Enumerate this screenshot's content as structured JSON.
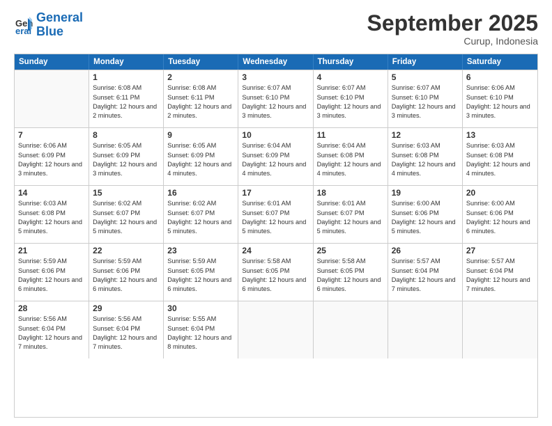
{
  "header": {
    "logo_line1": "General",
    "logo_line2": "Blue",
    "month_title": "September 2025",
    "location": "Curup, Indonesia"
  },
  "days_of_week": [
    "Sunday",
    "Monday",
    "Tuesday",
    "Wednesday",
    "Thursday",
    "Friday",
    "Saturday"
  ],
  "weeks": [
    [
      {
        "day": "",
        "sunrise": "",
        "sunset": "",
        "daylight": "",
        "empty": true
      },
      {
        "day": "1",
        "sunrise": "6:08 AM",
        "sunset": "6:11 PM",
        "daylight": "12 hours and 2 minutes."
      },
      {
        "day": "2",
        "sunrise": "6:08 AM",
        "sunset": "6:11 PM",
        "daylight": "12 hours and 2 minutes."
      },
      {
        "day": "3",
        "sunrise": "6:07 AM",
        "sunset": "6:10 PM",
        "daylight": "12 hours and 3 minutes."
      },
      {
        "day": "4",
        "sunrise": "6:07 AM",
        "sunset": "6:10 PM",
        "daylight": "12 hours and 3 minutes."
      },
      {
        "day": "5",
        "sunrise": "6:07 AM",
        "sunset": "6:10 PM",
        "daylight": "12 hours and 3 minutes."
      },
      {
        "day": "6",
        "sunrise": "6:06 AM",
        "sunset": "6:10 PM",
        "daylight": "12 hours and 3 minutes."
      }
    ],
    [
      {
        "day": "7",
        "sunrise": "6:06 AM",
        "sunset": "6:09 PM",
        "daylight": "12 hours and 3 minutes."
      },
      {
        "day": "8",
        "sunrise": "6:05 AM",
        "sunset": "6:09 PM",
        "daylight": "12 hours and 3 minutes."
      },
      {
        "day": "9",
        "sunrise": "6:05 AM",
        "sunset": "6:09 PM",
        "daylight": "12 hours and 4 minutes."
      },
      {
        "day": "10",
        "sunrise": "6:04 AM",
        "sunset": "6:09 PM",
        "daylight": "12 hours and 4 minutes."
      },
      {
        "day": "11",
        "sunrise": "6:04 AM",
        "sunset": "6:08 PM",
        "daylight": "12 hours and 4 minutes."
      },
      {
        "day": "12",
        "sunrise": "6:03 AM",
        "sunset": "6:08 PM",
        "daylight": "12 hours and 4 minutes."
      },
      {
        "day": "13",
        "sunrise": "6:03 AM",
        "sunset": "6:08 PM",
        "daylight": "12 hours and 4 minutes."
      }
    ],
    [
      {
        "day": "14",
        "sunrise": "6:03 AM",
        "sunset": "6:08 PM",
        "daylight": "12 hours and 5 minutes."
      },
      {
        "day": "15",
        "sunrise": "6:02 AM",
        "sunset": "6:07 PM",
        "daylight": "12 hours and 5 minutes."
      },
      {
        "day": "16",
        "sunrise": "6:02 AM",
        "sunset": "6:07 PM",
        "daylight": "12 hours and 5 minutes."
      },
      {
        "day": "17",
        "sunrise": "6:01 AM",
        "sunset": "6:07 PM",
        "daylight": "12 hours and 5 minutes."
      },
      {
        "day": "18",
        "sunrise": "6:01 AM",
        "sunset": "6:07 PM",
        "daylight": "12 hours and 5 minutes."
      },
      {
        "day": "19",
        "sunrise": "6:00 AM",
        "sunset": "6:06 PM",
        "daylight": "12 hours and 5 minutes."
      },
      {
        "day": "20",
        "sunrise": "6:00 AM",
        "sunset": "6:06 PM",
        "daylight": "12 hours and 6 minutes."
      }
    ],
    [
      {
        "day": "21",
        "sunrise": "5:59 AM",
        "sunset": "6:06 PM",
        "daylight": "12 hours and 6 minutes."
      },
      {
        "day": "22",
        "sunrise": "5:59 AM",
        "sunset": "6:06 PM",
        "daylight": "12 hours and 6 minutes."
      },
      {
        "day": "23",
        "sunrise": "5:59 AM",
        "sunset": "6:05 PM",
        "daylight": "12 hours and 6 minutes."
      },
      {
        "day": "24",
        "sunrise": "5:58 AM",
        "sunset": "6:05 PM",
        "daylight": "12 hours and 6 minutes."
      },
      {
        "day": "25",
        "sunrise": "5:58 AM",
        "sunset": "6:05 PM",
        "daylight": "12 hours and 6 minutes."
      },
      {
        "day": "26",
        "sunrise": "5:57 AM",
        "sunset": "6:04 PM",
        "daylight": "12 hours and 7 minutes."
      },
      {
        "day": "27",
        "sunrise": "5:57 AM",
        "sunset": "6:04 PM",
        "daylight": "12 hours and 7 minutes."
      }
    ],
    [
      {
        "day": "28",
        "sunrise": "5:56 AM",
        "sunset": "6:04 PM",
        "daylight": "12 hours and 7 minutes."
      },
      {
        "day": "29",
        "sunrise": "5:56 AM",
        "sunset": "6:04 PM",
        "daylight": "12 hours and 7 minutes."
      },
      {
        "day": "30",
        "sunrise": "5:55 AM",
        "sunset": "6:04 PM",
        "daylight": "12 hours and 8 minutes."
      },
      {
        "day": "",
        "empty": true
      },
      {
        "day": "",
        "empty": true
      },
      {
        "day": "",
        "empty": true
      },
      {
        "day": "",
        "empty": true
      }
    ]
  ],
  "labels": {
    "sunrise_prefix": "Sunrise: ",
    "sunset_prefix": "Sunset: ",
    "daylight_prefix": "Daylight: "
  }
}
